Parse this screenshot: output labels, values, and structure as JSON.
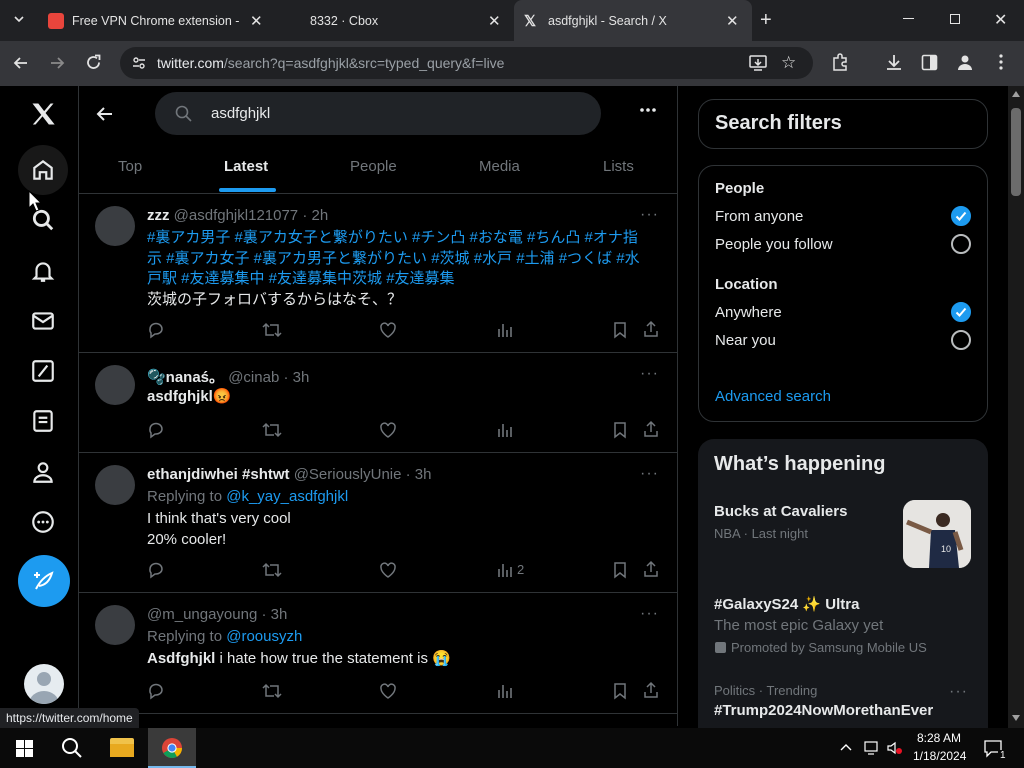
{
  "browser": {
    "tabs": [
      {
        "title": "Free VPN Chrome extension - B"
      },
      {
        "title": "8332 · Cbox"
      },
      {
        "title": "asdfghjkl - Search / X"
      }
    ],
    "url_host": "twitter.com",
    "url_path": "/search?q=asdfghjkl&src=typed_query&f=live",
    "status_link": "https://twitter.com/home"
  },
  "search": {
    "query": "asdfghjkl"
  },
  "tabs": [
    "Top",
    "Latest",
    "People",
    "Media",
    "Lists"
  ],
  "active_tab": "Latest",
  "tweets": [
    {
      "name": "zzz",
      "handle": "@asdfghjkl121077",
      "time": "· 2h",
      "line1": "#裏アカ男子 #裏アカ女子と繋がりたい #チン凸 #おな電 #ちん凸 #オナ指",
      "line2": "示 #裏アカ女子 #裏アカ男子と繋がりたい #茨城 #水戸 #土浦 #つくば #水",
      "line3": "戸駅 #友達募集中 #友達募集中茨城 #友達募集",
      "line4": "茨城の子フォロバするからはなそ、？"
    },
    {
      "name": "🫧nanaś。",
      "handle": "@cinab",
      "time": "· 3h",
      "text": "asdfghjkl😡"
    },
    {
      "name": "ethanjdiwhei #shtwt",
      "handle": "@SeriouslyUnie",
      "time": "· 3h",
      "reply_prefix": "Replying to",
      "reply_to": "@k_yay_asdfghjkl",
      "line1": "I think that's very cool",
      "line2": "20% cooler!",
      "views": "2"
    },
    {
      "name": "",
      "handle": "@m_ungayoung",
      "time": "· 3h",
      "reply_prefix": "Replying to",
      "reply_to": "@roousyzh",
      "text_bold": "Asdfghjkl",
      "text": " i hate how true the statement is 😭"
    }
  ],
  "filters": {
    "title": "Search filters",
    "people_label": "People",
    "from_anyone": "From anyone",
    "people_you_follow": "People you follow",
    "location_label": "Location",
    "anywhere": "Anywhere",
    "near_you": "Near you",
    "advanced": "Advanced search"
  },
  "happening": {
    "title": "What’s happening",
    "t1_title": "Bucks at Cavaliers",
    "t1_meta": "NBA · Last night",
    "t2_title": "#GalaxyS24 ✨ Ultra",
    "t2_desc": "The most epic Galaxy yet",
    "t2_promo": "Promoted by Samsung Mobile US",
    "t3_meta": "Politics · Trending",
    "t3_title": "#Trump2024NowMorethanEver"
  },
  "taskbar": {
    "time": "8:28 AM",
    "date": "1/18/2024",
    "notif_count": "1"
  },
  "colors": {
    "accent": "#1d9bf0",
    "bg": "#000000",
    "border": "#2f3336",
    "muted": "#71767b"
  }
}
